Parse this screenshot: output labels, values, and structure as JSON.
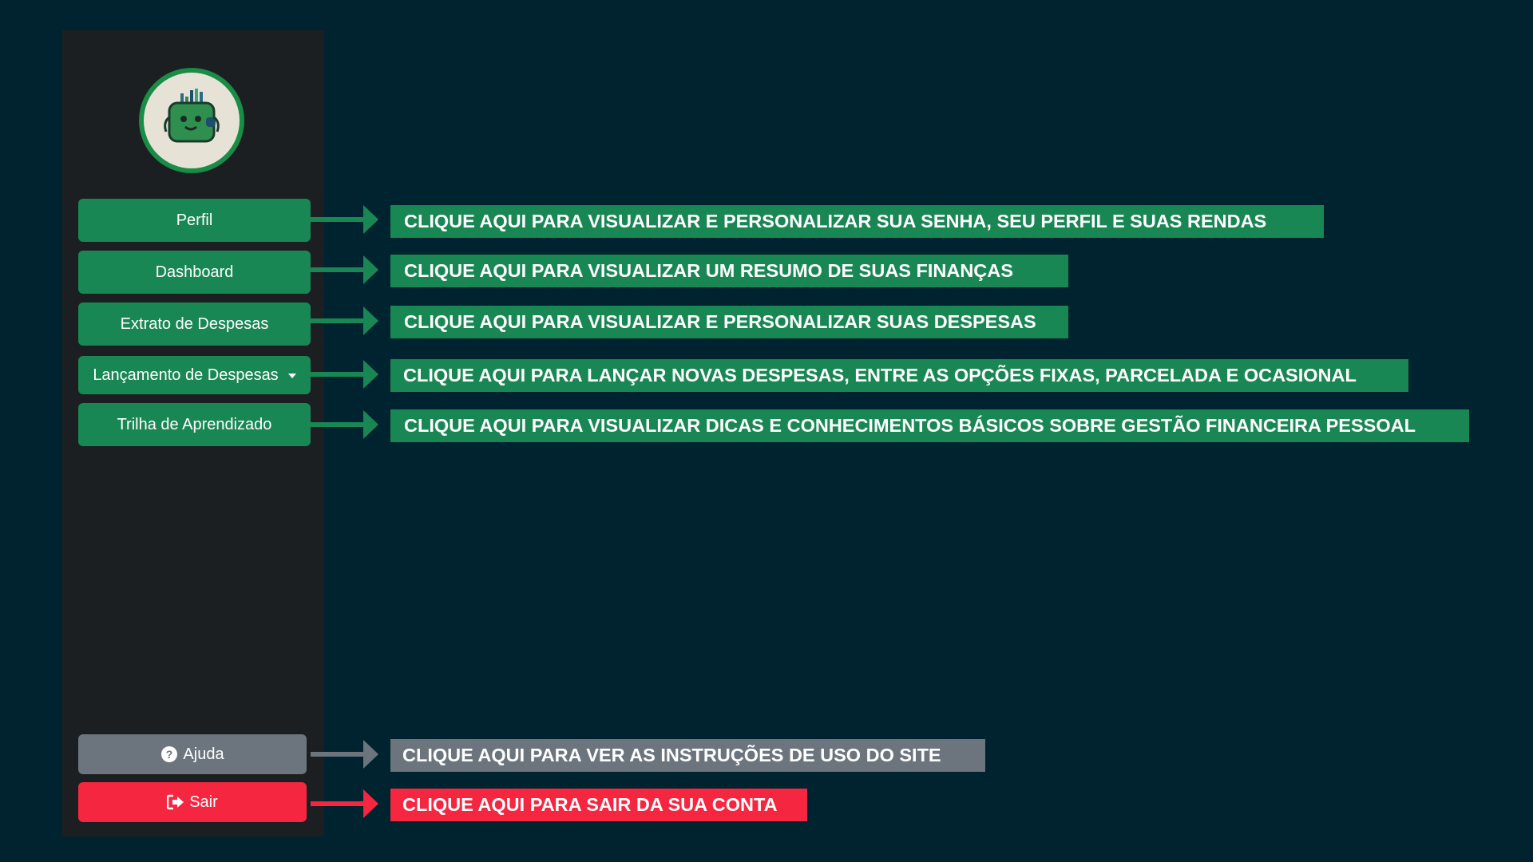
{
  "sidebar": {
    "logo_icon": "wallet-mascot-icon",
    "nav": [
      {
        "label": "Perfil",
        "callout": "CLIQUE AQUI PARA VISUALIZAR E PERSONALIZAR SUA SENHA, SEU PERFIL E SUAS RENDAS"
      },
      {
        "label": "Dashboard",
        "callout": "CLIQUE AQUI PARA VISUALIZAR UM RESUMO DE SUAS FINANÇAS"
      },
      {
        "label": "Extrato de Despesas",
        "callout": "CLIQUE AQUI PARA VISUALIZAR E PERSONALIZAR SUAS DESPESAS"
      },
      {
        "label": "Lançamento de Despesas",
        "callout": "CLIQUE AQUI PARA LANÇAR NOVAS DESPESAS, ENTRE AS OPÇÕES FIXAS, PARCELADA E OCASIONAL"
      },
      {
        "label": "Trilha de Aprendizado",
        "callout": "CLIQUE AQUI PARA VISUALIZAR DICAS E CONHECIMENTOS BÁSICOS SOBRE GESTÃO FINANCEIRA PESSOAL"
      }
    ],
    "help": {
      "label": "Ajuda",
      "icon": "question-circle-icon",
      "callout": "CLIQUE AQUI PARA VER AS INSTRUÇÕES DE USO DO SITE"
    },
    "logout": {
      "label": "Sair",
      "icon": "sign-out-icon",
      "callout": "CLIQUE AQUI PARA SAIR DA SUA CONTA"
    }
  },
  "colors": {
    "background": "#002330",
    "sidebar": "#1c1f22",
    "primary": "#198754",
    "secondary": "#6c757d",
    "danger": "#f5263f"
  }
}
